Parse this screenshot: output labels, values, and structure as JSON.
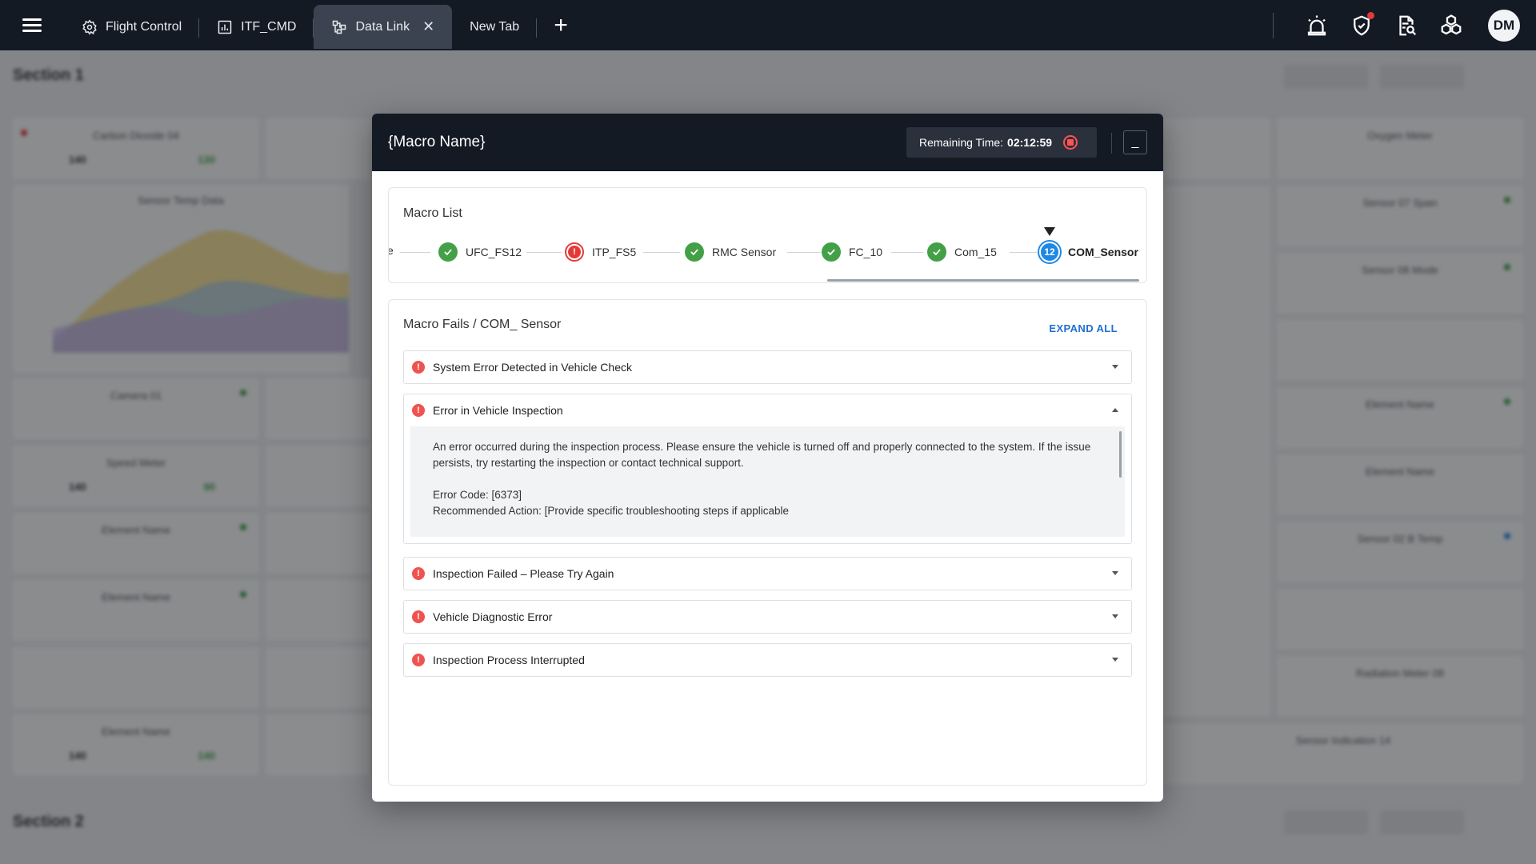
{
  "tabs": [
    {
      "label": "Flight Control",
      "icon": "gear-icon"
    },
    {
      "label": "ITF_CMD",
      "icon": "chart-icon"
    },
    {
      "label": "Data Link",
      "icon": "network-icon",
      "active": true
    },
    {
      "label": "New Tab",
      "icon": ""
    }
  ],
  "user": {
    "initials": "DM"
  },
  "background": {
    "section1": "Section 1",
    "section2": "Section 2",
    "cards": [
      "Carbon Dioxide 04",
      "Sensor Temp Data",
      "Camera 01",
      "Speed Meter",
      "Element Name",
      "Element Name",
      "Element Name",
      "Oxygen Meter",
      "Sensor 07 Span",
      "Sensor 08 Mode",
      "Element Name",
      "Element Name",
      "Sensor 02 B Temp",
      "Radiation Meter 08",
      "Sensor Indication 14"
    ]
  },
  "modal": {
    "title": "{Macro Name}",
    "remaining_label": "Remaining Time:",
    "remaining_time": "02:12:59",
    "minimize": "_",
    "macro_list_title": "Macro List",
    "partial_step_char": "e",
    "steps": [
      {
        "label": "UFC_FS12",
        "status": "success"
      },
      {
        "label": "ITP_FS5",
        "status": "error"
      },
      {
        "label": "RMC Sensor",
        "status": "success"
      },
      {
        "label": "FC_10",
        "status": "success"
      },
      {
        "label": "Com_15",
        "status": "success"
      },
      {
        "label": "COM_Sensor",
        "status": "current",
        "number": "12"
      }
    ],
    "fails_title": "Macro Fails / COM_ Sensor",
    "expand_all": "EXPAND ALL",
    "errors": [
      {
        "title": "System Error Detected in Vehicle Check",
        "expanded": false
      },
      {
        "title": "Error in Vehicle Inspection",
        "expanded": true,
        "description": "An error occurred during the inspection process. Please ensure the vehicle is turned off and properly connected to the system. If the issue persists, try restarting the inspection or contact technical support.",
        "error_code": "Error Code: [6373]",
        "recommended": "Recommended Action: [Provide specific troubleshooting steps if applicable"
      },
      {
        "title": "Inspection Failed – Please Try Again",
        "expanded": false
      },
      {
        "title": "Vehicle Diagnostic Error",
        "expanded": false
      },
      {
        "title": "Inspection Process Interrupted",
        "expanded": false
      }
    ]
  }
}
